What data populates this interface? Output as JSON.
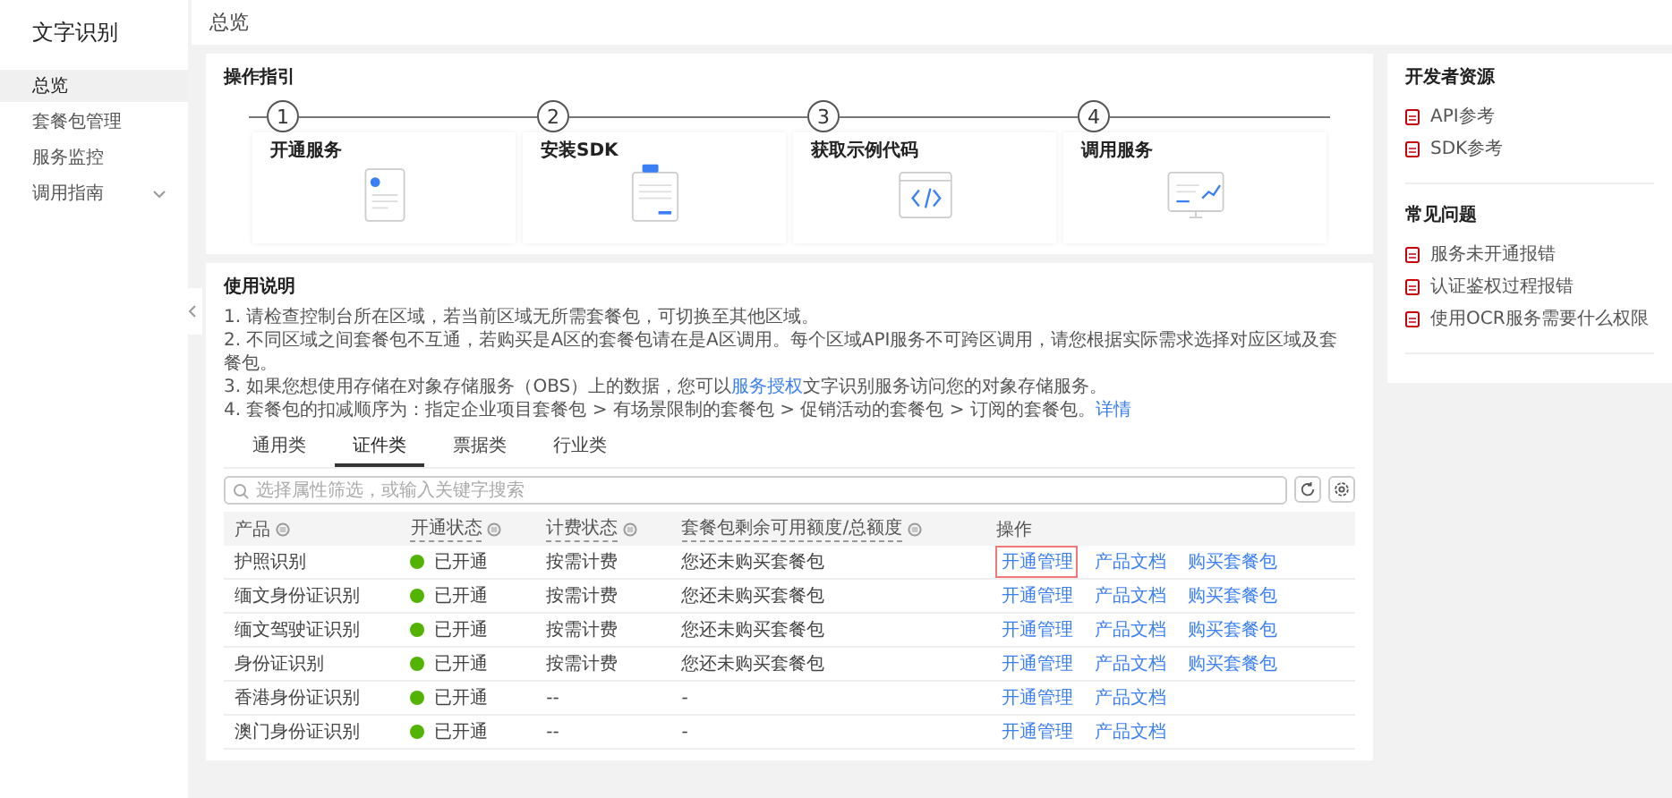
{
  "sidebar": {
    "title": "文字识别",
    "items": [
      {
        "label": "总览",
        "selected": true
      },
      {
        "label": "套餐包管理",
        "selected": false
      },
      {
        "label": "服务监控",
        "selected": false
      },
      {
        "label": "调用指南",
        "selected": false,
        "expandable": true
      }
    ]
  },
  "page_title": "总览",
  "guide": {
    "title": "操作指引",
    "steps": [
      {
        "number": "1",
        "label": "开通服务",
        "kind": "doc"
      },
      {
        "number": "2",
        "label": "安装SDK",
        "kind": "sdk"
      },
      {
        "number": "3",
        "label": "获取示例代码",
        "kind": "code"
      },
      {
        "number": "4",
        "label": "调用服务",
        "kind": "chart"
      }
    ]
  },
  "usage": {
    "title": "使用说明",
    "lines": [
      {
        "before": "1. 请检查控制台所在区域，若当前区域无所需套餐包，可切换至其他区域。"
      },
      {
        "before": "2. 不同区域之间套餐包不互通，若购买是A区的套餐包请在是A区调用。每个区域API服务不可跨区调用，请您根据实际需求选择对应区域及套餐包。"
      },
      {
        "before": "3. 如果您想使用存储在对象存储服务（OBS）上的数据，您可以",
        "link": "服务授权",
        "after": "文字识别服务访问您的对象存储服务。"
      },
      {
        "before": "4. 套餐包的扣减顺序为：指定企业项目套餐包 > 有场景限制的套餐包 > 促销活动的套餐包 > 订阅的套餐包。",
        "link": "详情"
      }
    ]
  },
  "tabs": [
    {
      "label": "通用类",
      "selected": false
    },
    {
      "label": "证件类",
      "selected": true
    },
    {
      "label": "票据类",
      "selected": false
    },
    {
      "label": "行业类",
      "selected": false
    }
  ],
  "search": {
    "placeholder": "选择属性筛选，或输入关键字搜索"
  },
  "table": {
    "columns": [
      {
        "label": "产品",
        "filter": true,
        "tooltip": false
      },
      {
        "label": "开通状态",
        "filter": true,
        "tooltip": true
      },
      {
        "label": "计费状态",
        "filter": true,
        "tooltip": true
      },
      {
        "label": "套餐包剩余可用额度/总额度",
        "filter": true,
        "tooltip": true
      },
      {
        "label": "操作",
        "filter": false,
        "tooltip": false
      }
    ],
    "rows": [
      {
        "product": "护照识别",
        "status": "已开通",
        "on": true,
        "billing": "按需计费",
        "package": "您还未购买套餐包",
        "actions": [
          {
            "label": "开通管理",
            "highlighted": true
          },
          {
            "label": "产品文档",
            "highlighted": false
          },
          {
            "label": "购买套餐包",
            "highlighted": false
          }
        ]
      },
      {
        "product": "缅文身份证识别",
        "status": "已开通",
        "on": true,
        "billing": "按需计费",
        "package": "您还未购买套餐包",
        "actions": [
          {
            "label": "开通管理",
            "highlighted": false
          },
          {
            "label": "产品文档",
            "highlighted": false
          },
          {
            "label": "购买套餐包",
            "highlighted": false
          }
        ]
      },
      {
        "product": "缅文驾驶证识别",
        "status": "已开通",
        "on": true,
        "billing": "按需计费",
        "package": "您还未购买套餐包",
        "actions": [
          {
            "label": "开通管理",
            "highlighted": false
          },
          {
            "label": "产品文档",
            "highlighted": false
          },
          {
            "label": "购买套餐包",
            "highlighted": false
          }
        ]
      },
      {
        "product": "身份证识别",
        "status": "已开通",
        "on": true,
        "billing": "按需计费",
        "package": "您还未购买套餐包",
        "actions": [
          {
            "label": "开通管理",
            "highlighted": false
          },
          {
            "label": "产品文档",
            "highlighted": false
          },
          {
            "label": "购买套餐包",
            "highlighted": false
          }
        ]
      },
      {
        "product": "香港身份证识别",
        "status": "已开通",
        "on": true,
        "billing": "--",
        "package": "-",
        "actions": [
          {
            "label": "开通管理",
            "highlighted": false
          },
          {
            "label": "产品文档",
            "highlighted": false
          }
        ]
      },
      {
        "product": "澳门身份证识别",
        "status": "已开通",
        "on": true,
        "billing": "--",
        "package": "-",
        "actions": [
          {
            "label": "开通管理",
            "highlighted": false
          },
          {
            "label": "产品文档",
            "highlighted": false
          }
        ]
      }
    ]
  },
  "resources": [
    {
      "title": "开发者资源",
      "links": [
        "API参考",
        "SDK参考"
      ]
    },
    {
      "title": "常见问题",
      "links": [
        "服务未开通报错",
        "认证鉴权过程报错",
        "使用OCR服务需要什么权限"
      ]
    }
  ]
}
